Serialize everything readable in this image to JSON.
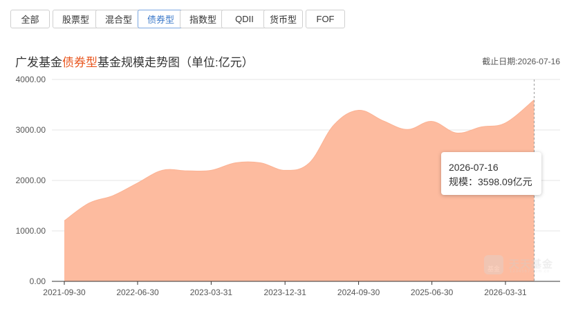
{
  "tabs": [
    {
      "label": "全部",
      "active": false
    },
    {
      "label": "股票型",
      "active": false
    },
    {
      "label": "混合型",
      "active": false
    },
    {
      "label": "债券型",
      "active": true
    },
    {
      "label": "指数型",
      "active": false
    },
    {
      "label": "QDII",
      "active": false
    },
    {
      "label": "货币型",
      "active": false
    },
    {
      "label": "FOF",
      "active": false
    }
  ],
  "header": {
    "title_prefix": "广发基金",
    "title_highlight": "债券型",
    "title_suffix": "基金规模走势图（单位:亿元）",
    "cutoff_date": "截止日期:2026-07-16"
  },
  "tooltip": {
    "date": "2026-07-16",
    "value_line": "规模：3598.09亿元"
  },
  "watermark": {
    "logo_text": "基金",
    "brand": "天天基金",
    "sub": "1234567.com.cn"
  },
  "colors": {
    "area_fill": "#fdbb9f",
    "highlight": "#e8551d",
    "active_tab": "#3a78c9"
  },
  "chart_data": {
    "type": "area",
    "title": "广发基金债券型基金规模走势图（单位:亿元）",
    "ylim": [
      0,
      4000
    ],
    "yticks": [
      0,
      1000,
      2000,
      3000,
      4000
    ],
    "ytick_labels": [
      "0.00",
      "1000.00",
      "2000.00",
      "3000.00",
      "4000.00"
    ],
    "xticks": [
      "2021-09-30",
      "2022-06-30",
      "2023-03-31",
      "2023-12-31",
      "2024-09-30",
      "2025-06-30",
      "2026-03-31"
    ],
    "grid": true,
    "points": [
      {
        "x": "2021-09-30",
        "y": 1200
      },
      {
        "x": "2021-12-31",
        "y": 1550
      },
      {
        "x": "2022-03-31",
        "y": 1700
      },
      {
        "x": "2022-06-30",
        "y": 1950
      },
      {
        "x": "2022-09-30",
        "y": 2200
      },
      {
        "x": "2022-12-31",
        "y": 2190
      },
      {
        "x": "2023-03-31",
        "y": 2200
      },
      {
        "x": "2023-06-30",
        "y": 2350
      },
      {
        "x": "2023-09-30",
        "y": 2350
      },
      {
        "x": "2023-12-31",
        "y": 2200
      },
      {
        "x": "2024-03-31",
        "y": 2350
      },
      {
        "x": "2024-06-30",
        "y": 3100
      },
      {
        "x": "2024-09-30",
        "y": 3390
      },
      {
        "x": "2024-12-31",
        "y": 3180
      },
      {
        "x": "2025-03-31",
        "y": 3010
      },
      {
        "x": "2025-06-30",
        "y": 3170
      },
      {
        "x": "2025-09-30",
        "y": 2940
      },
      {
        "x": "2025-12-31",
        "y": 3060
      },
      {
        "x": "2026-03-31",
        "y": 3140
      },
      {
        "x": "2026-07-16",
        "y": 3598.09
      }
    ]
  }
}
